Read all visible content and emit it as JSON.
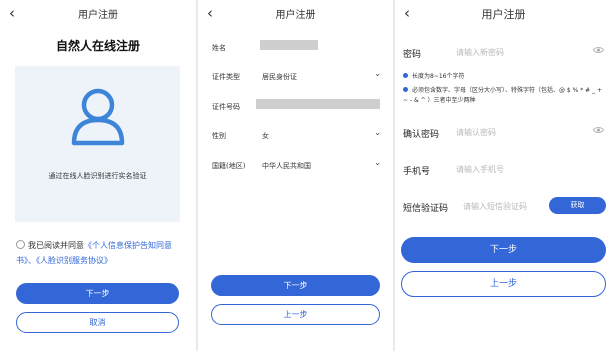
{
  "screen1": {
    "title": "用户注册",
    "heading": "自然人在线注册",
    "face_icon": "user-avatar-icon",
    "verify_text": "通过在线人脸识别进行实名验证",
    "agree_text": "我已阅读并同意",
    "link_privacy": "《个人信息保护告知同意书》",
    "sep": "、",
    "link_face": "《人脸识别服务协议》",
    "next_label": "下一步",
    "cancel_label": "取消"
  },
  "screen2": {
    "title": "用户注册",
    "fields": [
      {
        "label": "姓名",
        "value": ""
      },
      {
        "label": "证件类型",
        "value": "居民身份证"
      },
      {
        "label": "证件号码",
        "value": ""
      },
      {
        "label": "性别",
        "value": "女"
      },
      {
        "label": "国籍(地区)",
        "value": "中华人民共和国"
      }
    ],
    "next_label": "下一步",
    "prev_label": "上一步"
  },
  "screen3": {
    "title": "用户注册",
    "password_label": "密码",
    "password_placeholder": "请输入新密码",
    "hint1": "长度为8~16个字符",
    "hint2": "必须包含数字、字母（区分大小写）、特殊字符（包括、@ $ % * # _ + ~ - & ^ ）三者中至少两种",
    "confirm_label": "确认密码",
    "confirm_placeholder": "请输认密码",
    "phone_label": "手机号",
    "phone_placeholder": "请输入手机号",
    "sms_label": "短信验证码",
    "sms_placeholder": "请输入短信验证码",
    "get_code_label": "获取",
    "next_label": "下一步",
    "prev_label": "上一步"
  },
  "colors": {
    "accent": "#3366d6",
    "card": "#eef3fa"
  }
}
